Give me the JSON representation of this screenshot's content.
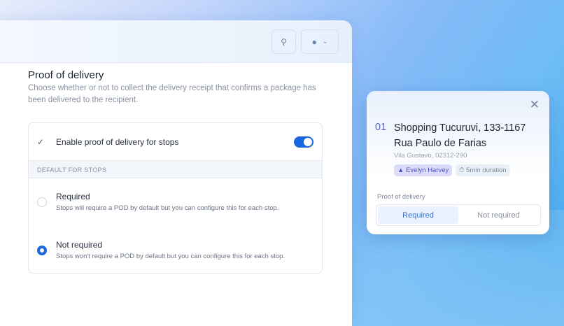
{
  "header": {
    "search_icon": "search-icon",
    "user_icon": "user-icon"
  },
  "settings": {
    "title": "Proof of delivery",
    "description": "Choose whether or not to collect the delivery receipt that confirms a package has been delivered to the recipient.",
    "enable_label": "Enable proof of delivery for stops",
    "enabled": true,
    "section_label": "DEFAULT FOR STOPS",
    "options": [
      {
        "label": "Required",
        "description": "Stops will require a POD by default but you can configure this for each stop.",
        "selected": false
      },
      {
        "label": "Not required",
        "description": "Stops won't require a POD by default but you can configure this for each stop.",
        "selected": true
      }
    ]
  },
  "popup": {
    "number": "01",
    "address": "Shopping Tucuruvi, 133-1167 Rua Paulo de Farias",
    "subtitle": "Vila Gustavo, 02312-290",
    "driver": "Evelyn Harvey",
    "duration": "5min duration",
    "pod_label": "Proof of delivery",
    "segments": [
      "Required",
      "Not required"
    ],
    "active_segment": "Required"
  },
  "colors": {
    "accent": "#1a66e0"
  }
}
